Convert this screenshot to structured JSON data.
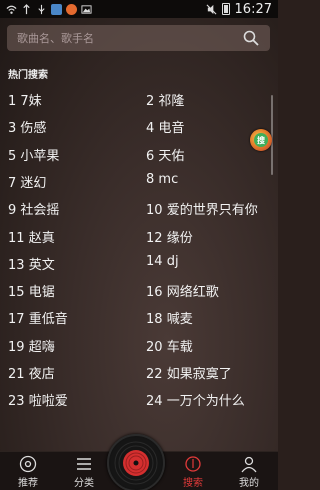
{
  "status_bar": {
    "time": "16:27",
    "icons": [
      "wifi-icon",
      "signal-icon",
      "usb-icon",
      "app-icon",
      "notification-icon",
      "mute-icon",
      "battery-icon"
    ]
  },
  "search": {
    "placeholder": "歌曲名、歌手名"
  },
  "hot_search": {
    "title": "热门搜索",
    "items": [
      {
        "rank": "1",
        "label": "7妹"
      },
      {
        "rank": "2",
        "label": "祁隆"
      },
      {
        "rank": "3",
        "label": "伤感"
      },
      {
        "rank": "4",
        "label": "电音"
      },
      {
        "rank": "5",
        "label": "小苹果"
      },
      {
        "rank": "6",
        "label": "天佑"
      },
      {
        "rank": "7",
        "label": "迷幻"
      },
      {
        "rank": "8",
        "label": "mc"
      },
      {
        "rank": "9",
        "label": "社会摇"
      },
      {
        "rank": "10",
        "label": "爱的世界只有你"
      },
      {
        "rank": "11",
        "label": "赵真"
      },
      {
        "rank": "12",
        "label": "缘份"
      },
      {
        "rank": "13",
        "label": "英文"
      },
      {
        "rank": "14",
        "label": "dj"
      },
      {
        "rank": "15",
        "label": "电锯"
      },
      {
        "rank": "16",
        "label": "网络红歌"
      },
      {
        "rank": "17",
        "label": "重低音"
      },
      {
        "rank": "18",
        "label": "喊麦"
      },
      {
        "rank": "19",
        "label": "超嗨"
      },
      {
        "rank": "20",
        "label": "车载"
      },
      {
        "rank": "21",
        "label": "夜店"
      },
      {
        "rank": "22",
        "label": "如果寂寞了"
      },
      {
        "rank": "23",
        "label": "啦啦爱"
      },
      {
        "rank": "24",
        "label": "一万个为什么"
      }
    ]
  },
  "floating_badge": {
    "label": "搜"
  },
  "bottom_nav": {
    "items": [
      {
        "label": "推荐",
        "icon": "disc-icon"
      },
      {
        "label": "分类",
        "icon": "menu-icon"
      },
      {
        "label": "",
        "icon": "play-disc-icon"
      },
      {
        "label": "搜索",
        "icon": "search-icon"
      },
      {
        "label": "我的",
        "icon": "user-icon"
      }
    ]
  },
  "colors": {
    "accent": "#e23a3a",
    "background": "#3a2d2a",
    "status_bar": "#0d0b0a"
  }
}
